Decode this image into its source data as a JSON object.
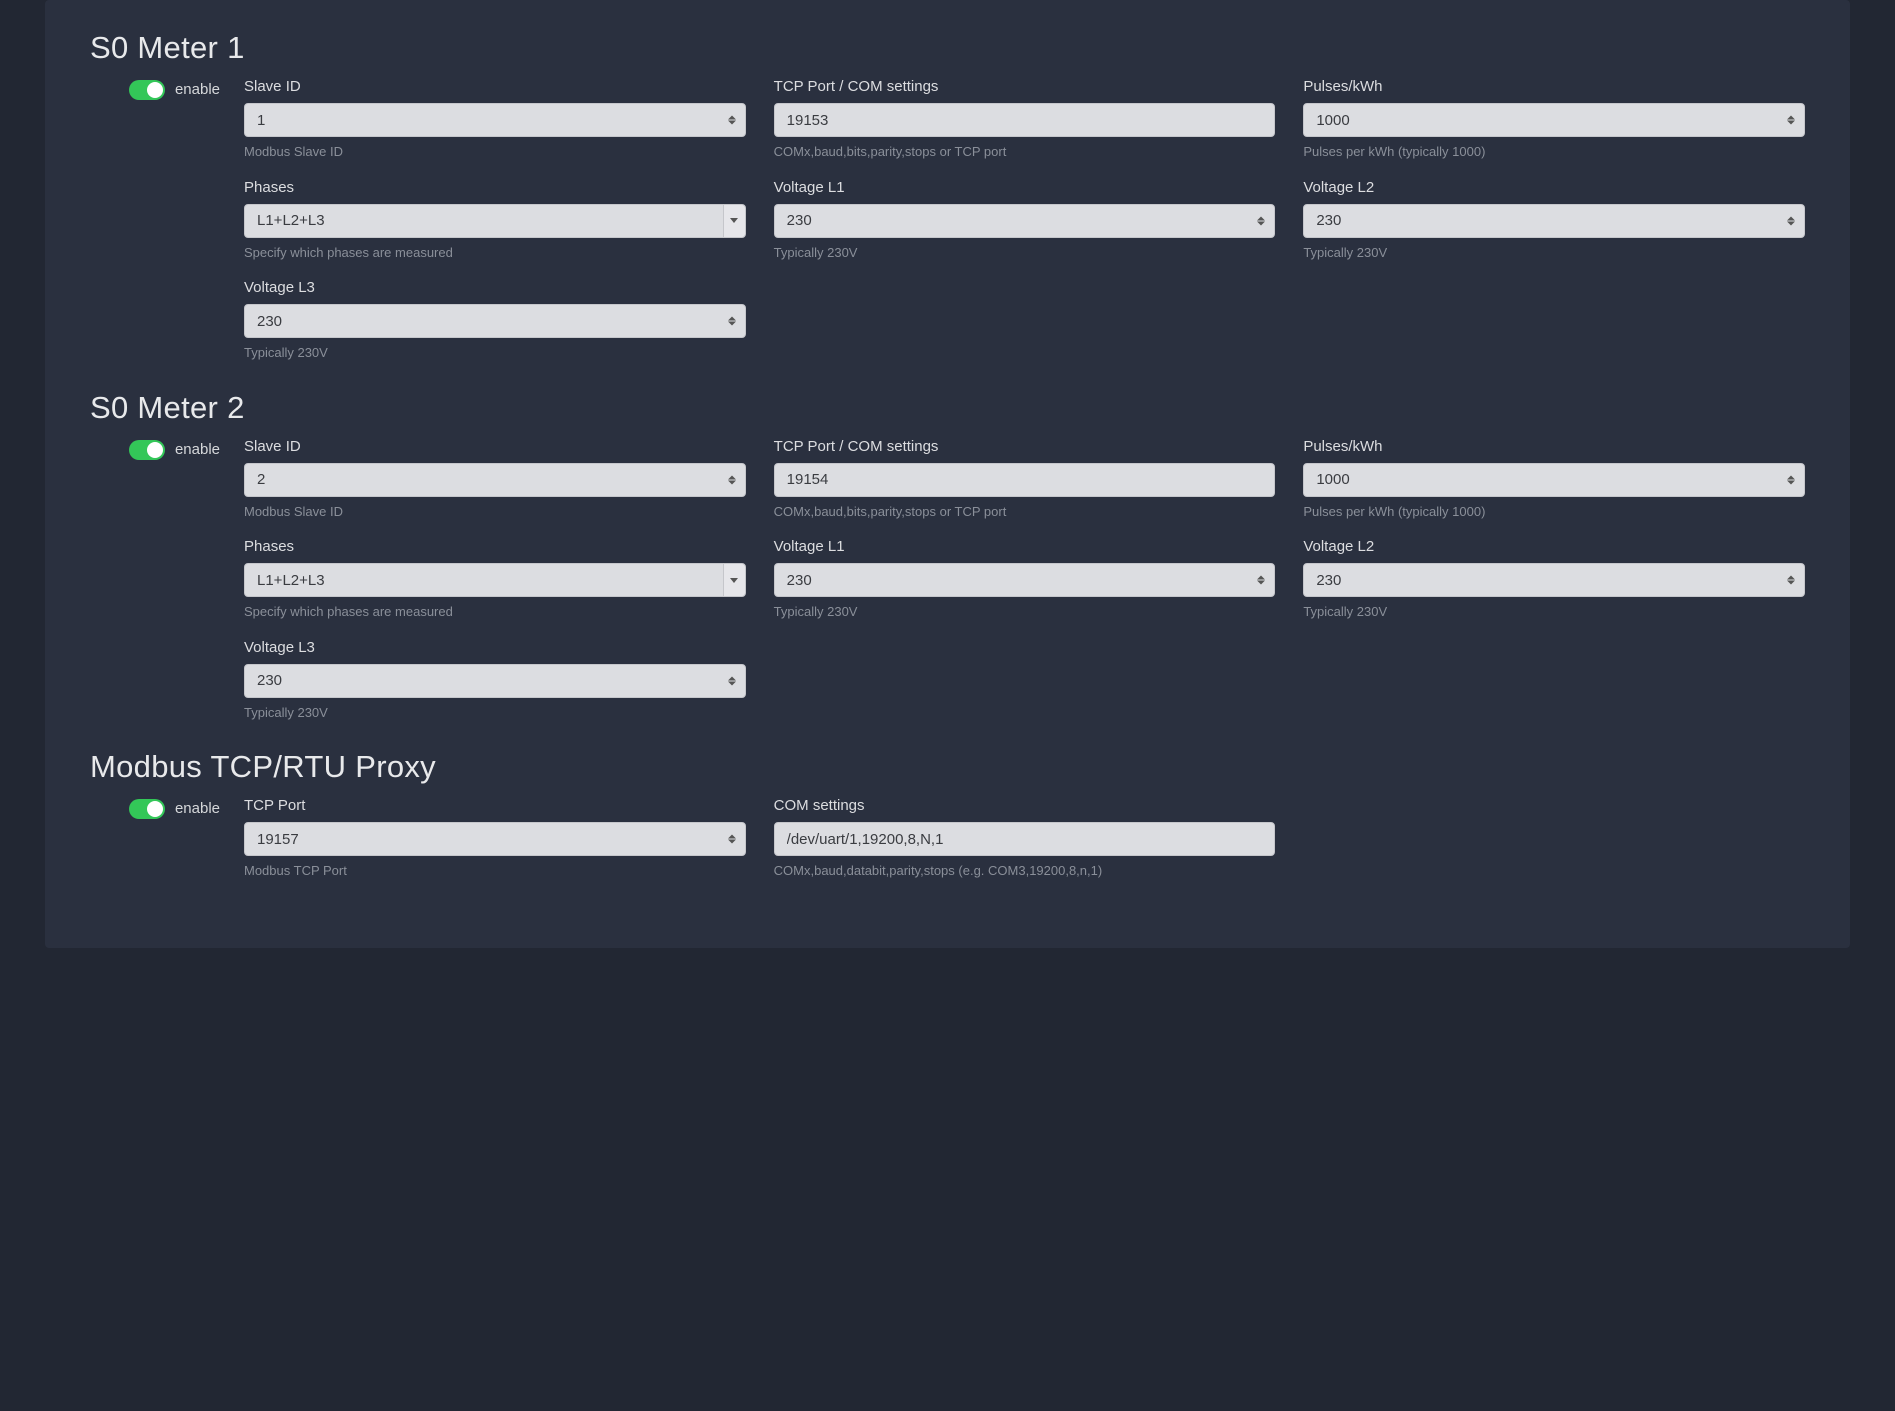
{
  "sections": [
    {
      "title": "S0 Meter 1",
      "enable_label": "enable",
      "fields": {
        "slave_id": {
          "label": "Slave ID",
          "value": "1",
          "help": "Modbus Slave ID"
        },
        "tcp_com": {
          "label": "TCP Port / COM settings",
          "value": "19153",
          "help": "COMx,baud,bits,parity,stops or TCP port"
        },
        "pulses": {
          "label": "Pulses/kWh",
          "value": "1000",
          "help": "Pulses per kWh (typically 1000)"
        },
        "phases": {
          "label": "Phases",
          "value": "L1+L2+L3",
          "help": "Specify which phases are measured"
        },
        "voltage_l1": {
          "label": "Voltage L1",
          "value": "230",
          "help": "Typically 230V"
        },
        "voltage_l2": {
          "label": "Voltage L2",
          "value": "230",
          "help": "Typically 230V"
        },
        "voltage_l3": {
          "label": "Voltage L3",
          "value": "230",
          "help": "Typically 230V"
        }
      }
    },
    {
      "title": "S0 Meter 2",
      "enable_label": "enable",
      "fields": {
        "slave_id": {
          "label": "Slave ID",
          "value": "2",
          "help": "Modbus Slave ID"
        },
        "tcp_com": {
          "label": "TCP Port / COM settings",
          "value": "19154",
          "help": "COMx,baud,bits,parity,stops or TCP port"
        },
        "pulses": {
          "label": "Pulses/kWh",
          "value": "1000",
          "help": "Pulses per kWh (typically 1000)"
        },
        "phases": {
          "label": "Phases",
          "value": "L1+L2+L3",
          "help": "Specify which phases are measured"
        },
        "voltage_l1": {
          "label": "Voltage L1",
          "value": "230",
          "help": "Typically 230V"
        },
        "voltage_l2": {
          "label": "Voltage L2",
          "value": "230",
          "help": "Typically 230V"
        },
        "voltage_l3": {
          "label": "Voltage L3",
          "value": "230",
          "help": "Typically 230V"
        }
      }
    }
  ],
  "proxy": {
    "title": "Modbus TCP/RTU Proxy",
    "enable_label": "enable",
    "fields": {
      "tcp_port": {
        "label": "TCP Port",
        "value": "19157",
        "help": "Modbus TCP Port"
      },
      "com": {
        "label": "COM settings",
        "value": "/dev/uart/1,19200,8,N,1",
        "help": "COMx,baud,databit,parity,stops (e.g. COM3,19200,8,n,1)"
      }
    }
  }
}
